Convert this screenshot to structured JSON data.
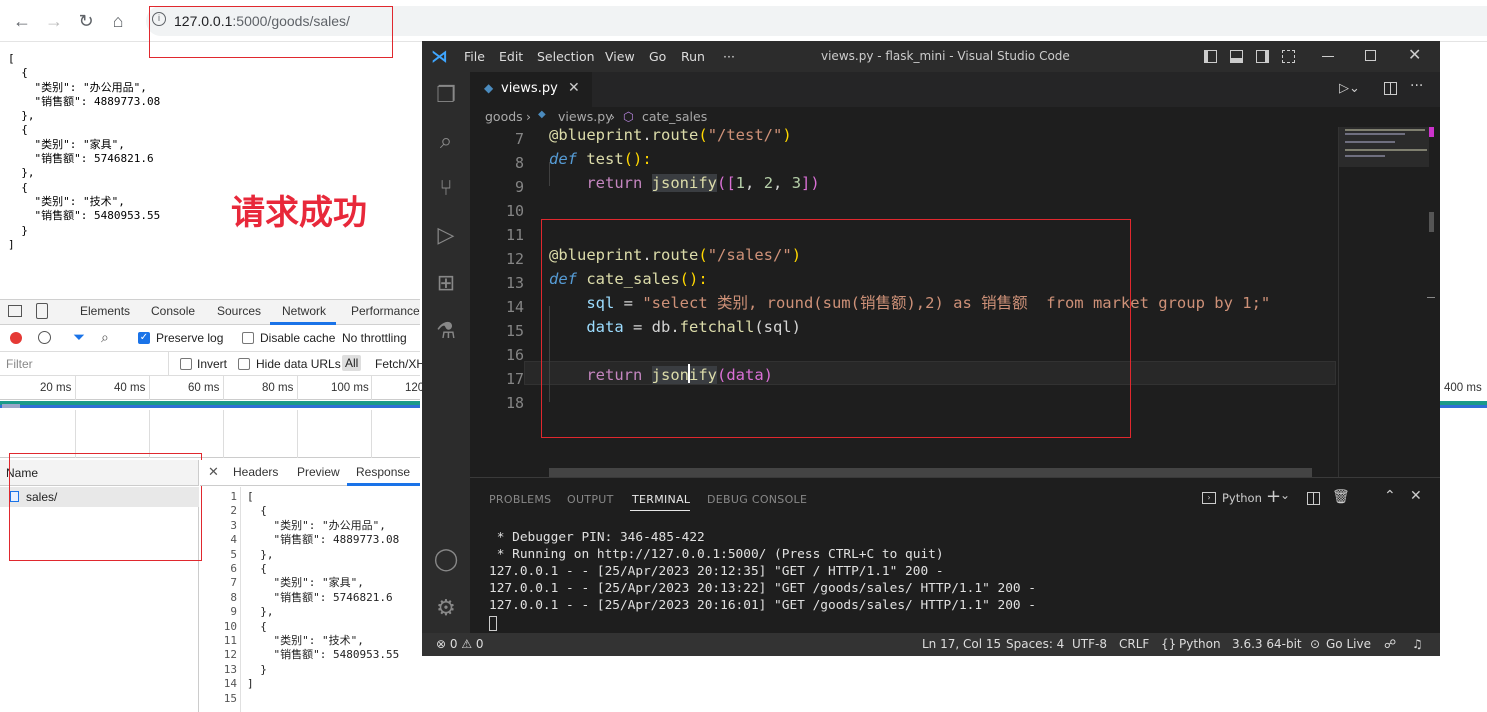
{
  "browser": {
    "url_host": "127.0.0.1",
    "url_path": ":5000/goods/sales/"
  },
  "page_json": "[\n  {\n    \"类别\": \"办公用品\",\n    \"销售额\": 4889773.08\n  },\n  {\n    \"类别\": \"家具\",\n    \"销售额\": 5746821.6\n  },\n  {\n    \"类别\": \"技术\",\n    \"销售额\": 5480953.55\n  }\n]",
  "annotation": "请求成功",
  "devtools": {
    "tabs": [
      "Elements",
      "Console",
      "Sources",
      "Network",
      "Performance"
    ],
    "preserve_log": "Preserve log",
    "disable_cache": "Disable cache",
    "throttling": "No throttling",
    "filter_placeholder": "Filter",
    "invert": "Invert",
    "hide_data_urls": "Hide data URLs",
    "all": "All",
    "fetch": "Fetch/XH",
    "ticks": [
      "20 ms",
      "40 ms",
      "60 ms",
      "80 ms",
      "100 ms",
      "120",
      "400 ms"
    ],
    "name_header": "Name",
    "request_name": "sales/",
    "resp_tabs": [
      "Headers",
      "Preview",
      "Response"
    ],
    "response_gutter": "1\n2\n3\n4\n5\n6\n7\n8\n9\n10\n11\n12\n13\n14\n15",
    "response_body": "[\n  {\n    \"类别\": \"办公用品\",\n    \"销售额\": 4889773.08\n  },\n  {\n    \"类别\": \"家具\",\n    \"销售额\": 5746821.6\n  },\n  {\n    \"类别\": \"技术\",\n    \"销售额\": 5480953.55\n  }\n]\n"
  },
  "vscode": {
    "menu": [
      "File",
      "Edit",
      "Selection",
      "View",
      "Go",
      "Run",
      "···"
    ],
    "window_title": "views.py - flask_mini - Visual Studio Code",
    "tab_name": "views.py",
    "breadcrumb": [
      "goods",
      "views.py",
      "cate_sales"
    ],
    "line_numbers": "7\n8\n9\n10\n11\n12\n13\n14\n15\n16\n17\n18",
    "code": {
      "l7a": "@blueprint",
      "l7b": ".",
      "l7c": "route",
      "l7d": "(",
      "l7e": "\"/test/\"",
      "l7f": ")",
      "l8a": "def",
      "l8b": " test",
      "l8c": "():",
      "l9a": "return",
      "l9b": "jsonify",
      "l9c": "([",
      "l9d": "1",
      "l9e": ", ",
      "l9f": "2",
      "l9g": ", ",
      "l9h": "3",
      "l9i": "])",
      "l12a": "@blueprint",
      "l12b": ".",
      "l12c": "route",
      "l12d": "(",
      "l12e": "\"/sales/\"",
      "l12f": ")",
      "l13a": "def",
      "l13b": " cate_sales",
      "l13c": "():",
      "l14a": "sql",
      "l14b": " = ",
      "l14c": "\"select 类别, round(sum(销售额),2) as 销售额  from market group by 1;\"",
      "l15a": "data",
      "l15b": " = db.",
      "l15c": "fetchall",
      "l15d": "(sql)",
      "l17a": "return",
      "l17b": "jsonify",
      "l17c": "(data)"
    },
    "panel_tabs": [
      "PROBLEMS",
      "OUTPUT",
      "TERMINAL",
      "DEBUG CONSOLE"
    ],
    "shell": "Python",
    "terminal": " * Debugger PIN: 346-485-422\n * Running on http://127.0.0.1:5000/ (Press CTRL+C to quit)\n127.0.0.1 - - [25/Apr/2023 20:12:35] \"GET / HTTP/1.1\" 200 -\n127.0.0.1 - - [25/Apr/2023 20:13:22] \"GET /goods/sales/ HTTP/1.1\" 200 -\n127.0.0.1 - - [25/Apr/2023 20:16:01] \"GET /goods/sales/ HTTP/1.1\" 200 -",
    "status": {
      "problems": "⊗ 0 ⚠ 0",
      "position": "Ln 17, Col 15",
      "spaces": "Spaces: 4",
      "encoding": "UTF-8",
      "eol": "CRLF",
      "language": "Python",
      "interpreter": "3.6.3 64-bit",
      "golive": "Go Live"
    }
  },
  "colors": {
    "accent_red": "#e0282e",
    "vscode_bg": "#1e1e1e"
  }
}
